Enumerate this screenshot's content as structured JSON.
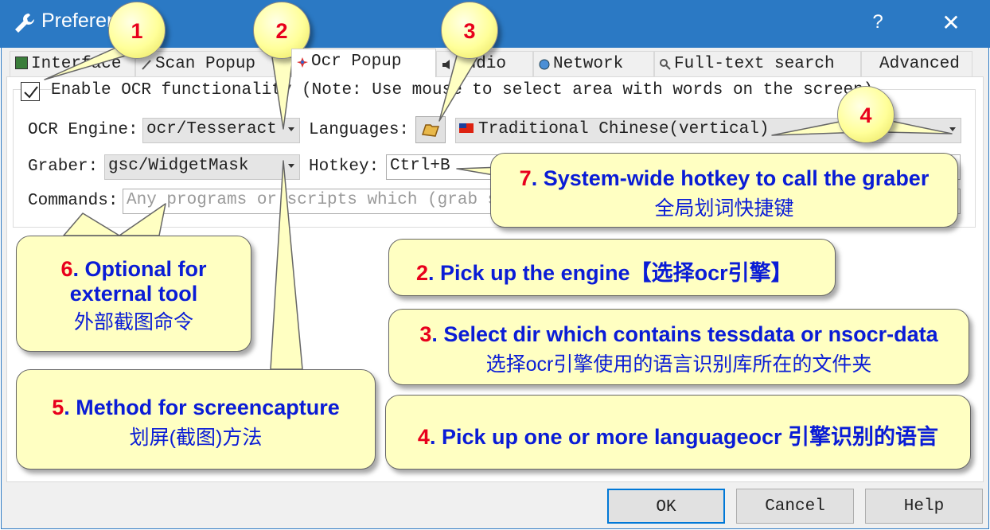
{
  "window": {
    "title": "Preferen",
    "help_glyph": "?",
    "close_glyph": "✕"
  },
  "tabs": [
    {
      "label": "Interface",
      "icon": "monitor-icon"
    },
    {
      "label": "Scan Popup",
      "icon": "wand-icon"
    },
    {
      "label": "Ocr Popup",
      "icon": "color-star-icon"
    },
    {
      "label": "Audio",
      "icon": "speaker-icon"
    },
    {
      "label": "Network",
      "icon": "globe-icon"
    },
    {
      "label": "Full-text search",
      "icon": "magnifier-icon"
    },
    {
      "label": "Advanced",
      "icon": ""
    }
  ],
  "ocr": {
    "enable_label": "Enable OCR functionality (Note: Use mouse to select area with words on the screen)",
    "enable_checked": true,
    "engine_label": "OCR Engine:",
    "engine_value": "ocr/Tesseract",
    "languages_label": "Languages:",
    "languages_value": "Traditional Chinese(vertical)",
    "graber_label": "Graber:",
    "graber_value": "gsc/WidgetMask",
    "hotkey_label": "Hotkey:",
    "hotkey_value": "Ctrl+B",
    "commands_label": "Commands:",
    "commands_placeholder": "Any programs or scripts which (grab sc"
  },
  "buttons": {
    "ok": "OK",
    "cancel": "Cancel",
    "help": "Help"
  },
  "bubbles": [
    "1",
    "2",
    "3",
    "4"
  ],
  "notes": {
    "n7": {
      "num": "7",
      "en": ". System-wide hotkey to call the graber",
      "cn": "全局划词快捷键"
    },
    "n2": {
      "num": "2",
      "en": ". Pick up the engine【选择ocr引擎】"
    },
    "n6": {
      "num": "6",
      "en1": ". Optional for",
      "en2": "external tool",
      "cn": "外部截图命令"
    },
    "n3": {
      "num": "3",
      "en": ". Select dir which contains tessdata or nsocr-data",
      "cn": "选择ocr引擎使用的语言识别库所在的文件夹"
    },
    "n5": {
      "num": "5",
      "en": ". Method for screencapture",
      "cn": "划屏(截图)方法"
    },
    "n4": {
      "num": "4",
      "en": ". Pick up one or more languageocr 引擎识别的语言"
    }
  },
  "colors": {
    "titlebar": "#2b79c4",
    "note_bg": "#ffffc2",
    "note_text": "#0a1cd6",
    "number_red": "#e8001c"
  }
}
